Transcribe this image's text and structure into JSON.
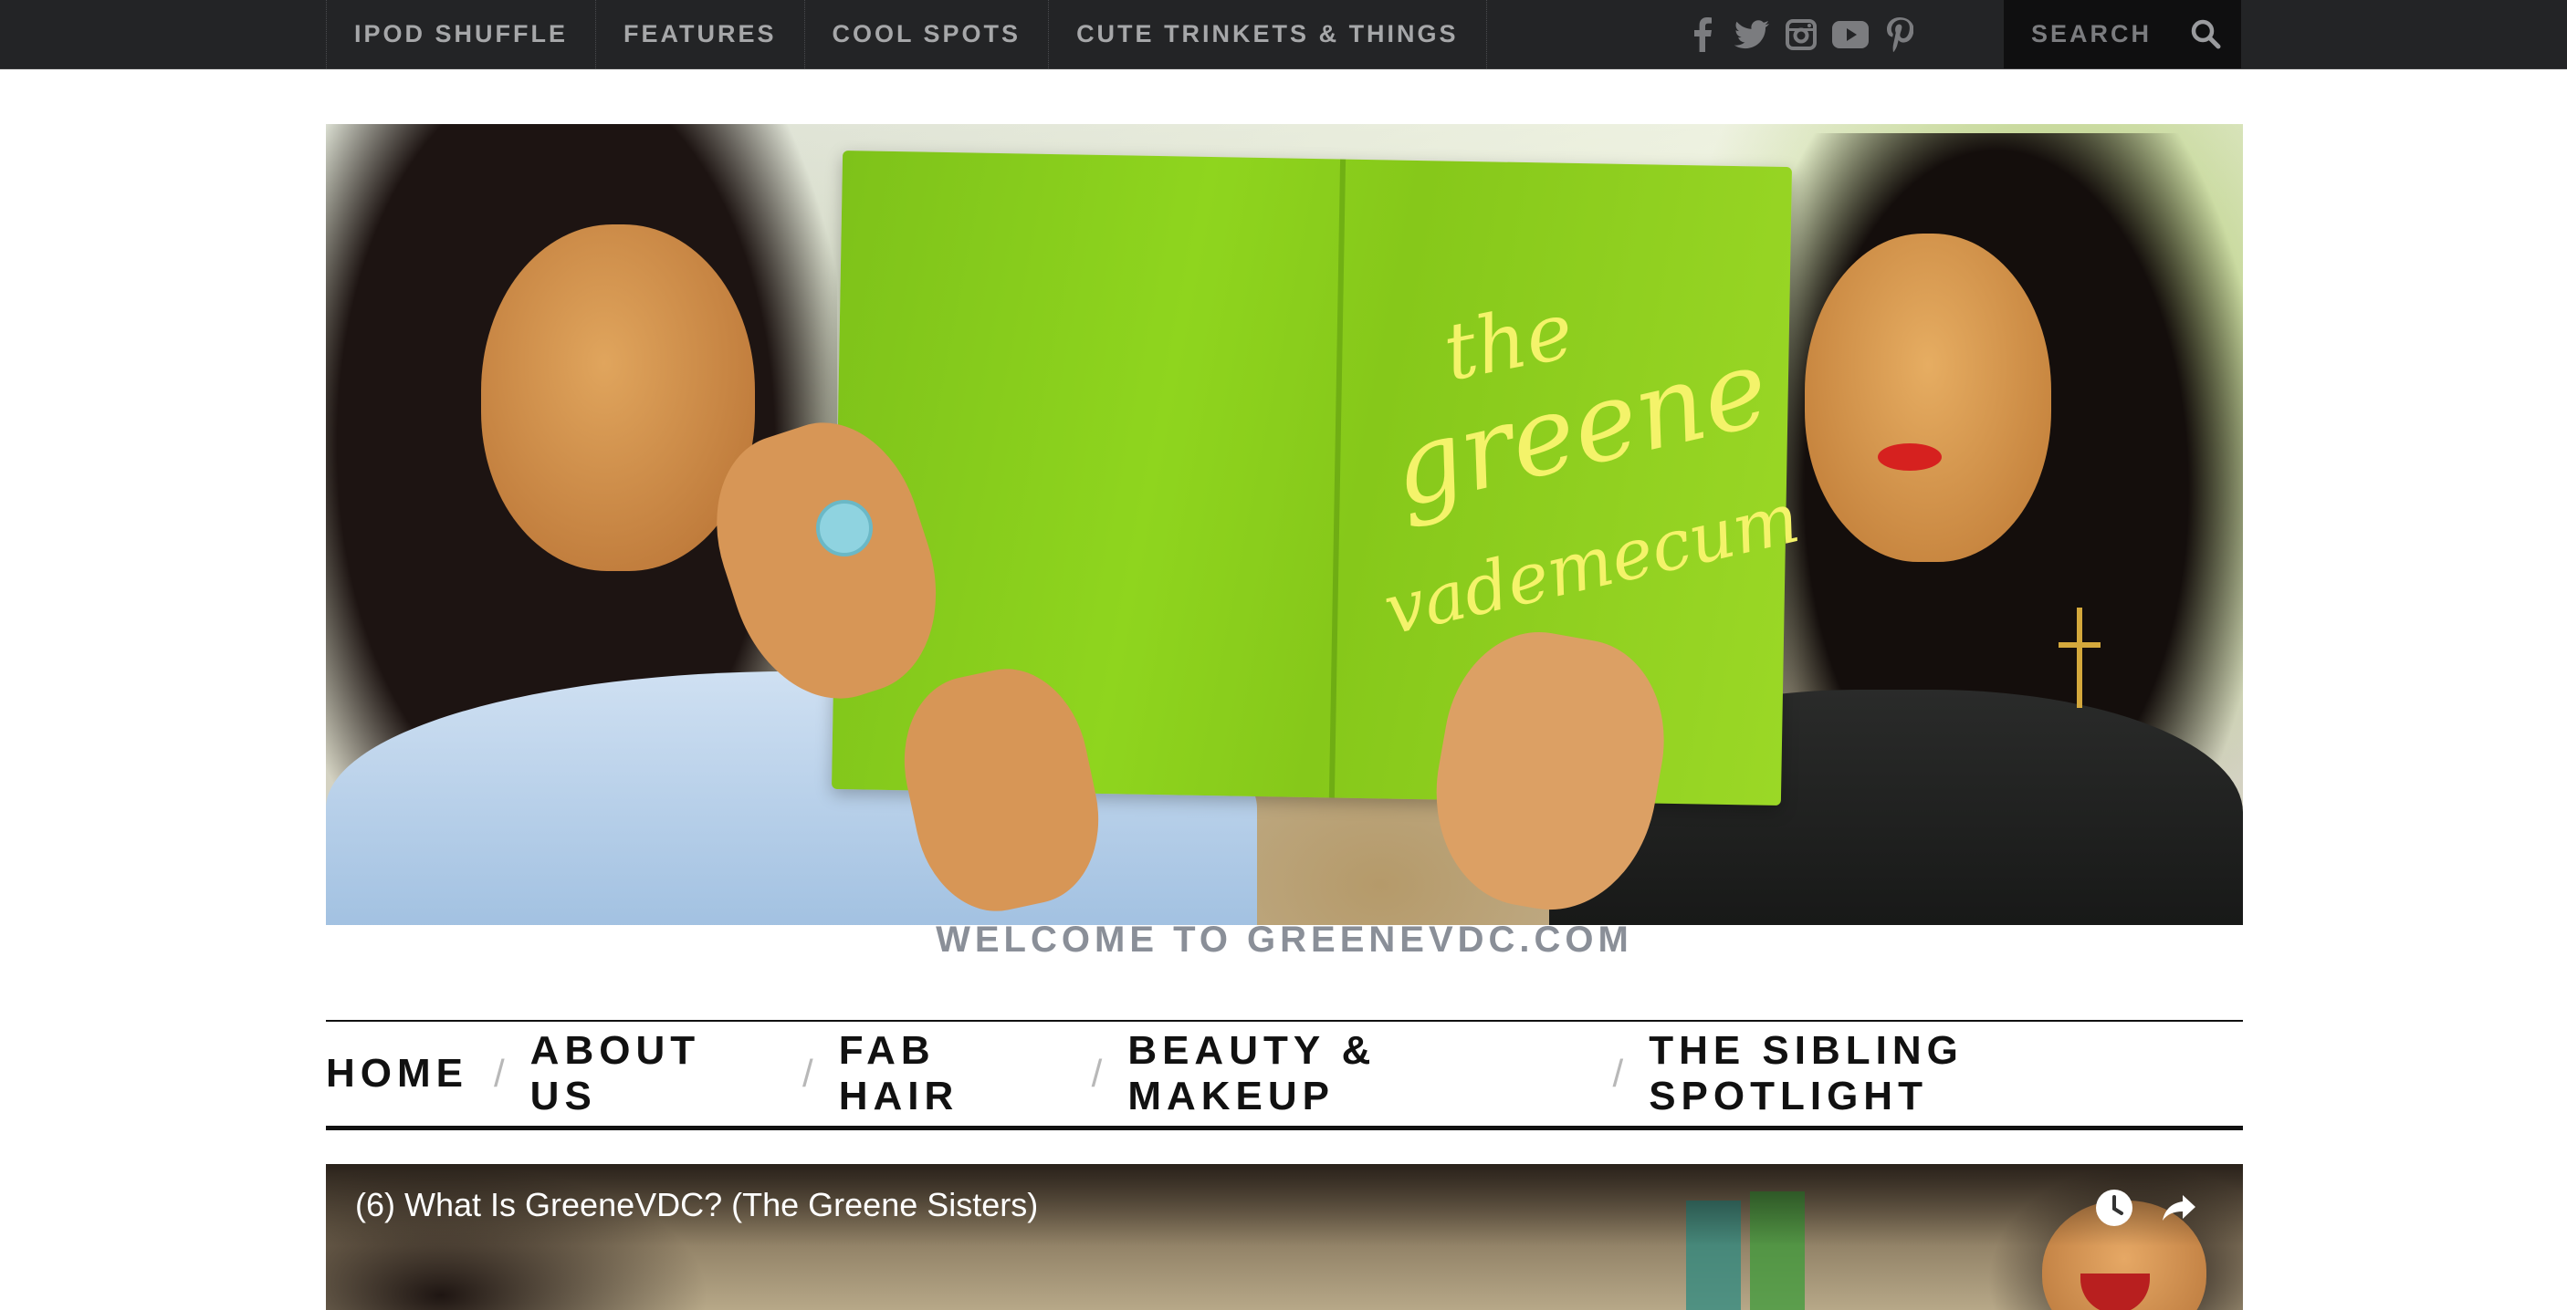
{
  "topbar": {
    "nav": [
      "IPOD SHUFFLE",
      "FEATURES",
      "COOL SPOTS",
      "CUTE TRINKETS & THINGS"
    ],
    "social": [
      "facebook-icon",
      "twitter-icon",
      "instagram-icon",
      "youtube-icon",
      "pinterest-icon"
    ],
    "search_placeholder": "SEARCH"
  },
  "header": {
    "logo_line1": "the",
    "logo_line2": "greene",
    "logo_line3": "vademecum",
    "tagline": "WELCOME TO GREENEVDC.COM"
  },
  "mainnav": {
    "items": [
      "HOME",
      "ABOUT US",
      "FAB HAIR",
      "BEAUTY & MAKEUP",
      "THE SIBLING SPOTLIGHT"
    ],
    "separator": "/"
  },
  "video": {
    "title": "(6) What Is GreeneVDC? (The Greene Sisters)",
    "buttons": [
      "watch-later-icon",
      "share-icon"
    ]
  },
  "colors": {
    "topbar_bg": "#232426",
    "search_bg": "#0f0f10",
    "book_green": "#86c81a",
    "logo_yellow": "#f4f36a",
    "tagline_gray": "#8a8f98"
  }
}
